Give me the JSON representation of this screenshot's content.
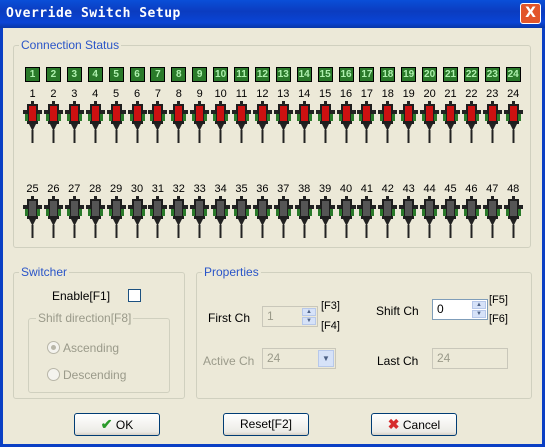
{
  "window": {
    "title": "Override Switch Setup",
    "close_glyph": "X"
  },
  "connection_status": {
    "label": "Connection Status",
    "row1_boxes": [
      "1",
      "2",
      "3",
      "4",
      "5",
      "6",
      "7",
      "8",
      "9",
      "10",
      "11",
      "12",
      "13",
      "14",
      "15",
      "16",
      "17",
      "18",
      "19",
      "20",
      "21",
      "22",
      "23",
      "24"
    ],
    "row1_numbers": [
      "1",
      "2",
      "3",
      "4",
      "5",
      "6",
      "7",
      "8",
      "9",
      "10",
      "11",
      "12",
      "13",
      "14",
      "15",
      "16",
      "17",
      "18",
      "19",
      "20",
      "21",
      "22",
      "23",
      "24"
    ],
    "row2_numbers": [
      "25",
      "26",
      "27",
      "28",
      "29",
      "30",
      "31",
      "32",
      "33",
      "34",
      "35",
      "36",
      "37",
      "38",
      "39",
      "40",
      "41",
      "42",
      "43",
      "44",
      "45",
      "46",
      "47",
      "48"
    ],
    "row1_color": "#cc1111",
    "row2_color": "#555555"
  },
  "switcher": {
    "label": "Switcher",
    "enable_label": "Enable[F1]",
    "shift_direction_label": "Shift direction[F8]",
    "ascending_label": "Ascending",
    "descending_label": "Descending"
  },
  "properties": {
    "label": "Properties",
    "first_ch_label": "First Ch",
    "first_ch_value": "1",
    "first_ch_keys": [
      "[F3]",
      "[F4]"
    ],
    "shift_ch_label": "Shift Ch",
    "shift_ch_value": "0",
    "shift_ch_keys": [
      "[F5]",
      "[F6]"
    ],
    "active_ch_label": "Active Ch",
    "active_ch_value": "24",
    "last_ch_label": "Last Ch",
    "last_ch_value": "24"
  },
  "buttons": {
    "ok": "OK",
    "reset": "Reset[F2]",
    "cancel": "Cancel"
  }
}
